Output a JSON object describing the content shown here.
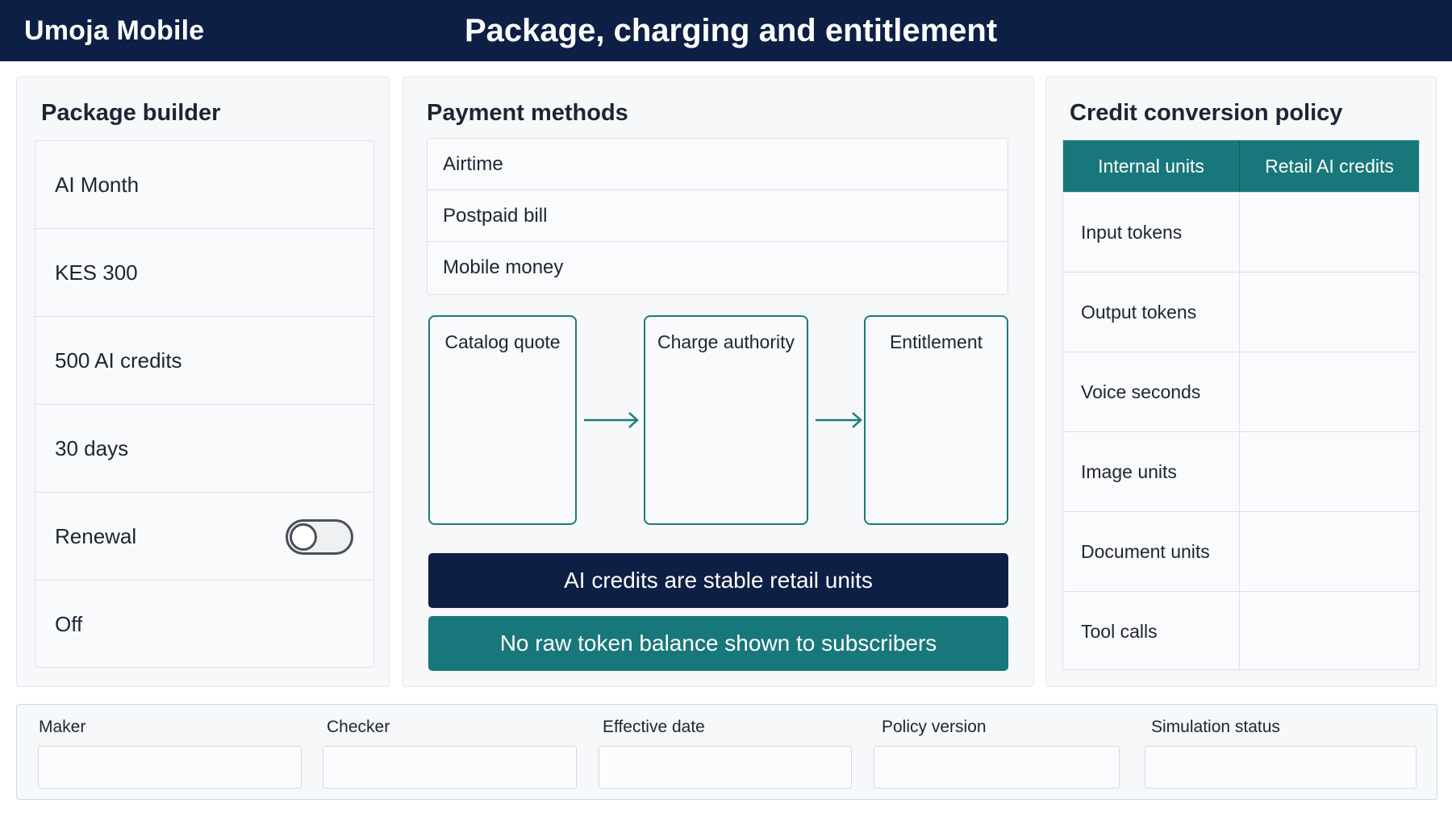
{
  "header": {
    "brand": "Umoja Mobile",
    "title": "Package, charging and entitlement"
  },
  "package_builder": {
    "title": "Package builder",
    "rows": [
      "AI Month",
      "KES 300",
      "500 AI credits",
      "30 days",
      "Renewal",
      "Off"
    ],
    "renewal_toggle": {
      "on": false
    }
  },
  "payment_methods": {
    "title": "Payment methods",
    "methods": [
      "Airtime",
      "Postpaid bill",
      "Mobile money"
    ],
    "flow": [
      "Catalog quote",
      "Charge authority",
      "Entitlement"
    ],
    "banner_primary": "AI credits are stable retail units",
    "banner_secondary": "No raw token balance shown to subscribers"
  },
  "credit_conversion": {
    "title": "Credit conversion policy",
    "columns": [
      "Internal units",
      "Retail AI credits"
    ],
    "rows": [
      {
        "unit": "Input tokens",
        "credits": ""
      },
      {
        "unit": "Output tokens",
        "credits": ""
      },
      {
        "unit": "Voice seconds",
        "credits": ""
      },
      {
        "unit": "Image units",
        "credits": ""
      },
      {
        "unit": "Document units",
        "credits": ""
      },
      {
        "unit": "Tool calls",
        "credits": ""
      }
    ]
  },
  "footer": {
    "fields": [
      {
        "label": "Maker",
        "value": ""
      },
      {
        "label": "Checker",
        "value": ""
      },
      {
        "label": "Effective date",
        "value": ""
      },
      {
        "label": "Policy version",
        "value": ""
      },
      {
        "label": "Simulation status",
        "value": ""
      }
    ]
  },
  "colors": {
    "navy": "#0d1f44",
    "teal": "#18777a",
    "panel_bg": "#f6f8f9"
  }
}
